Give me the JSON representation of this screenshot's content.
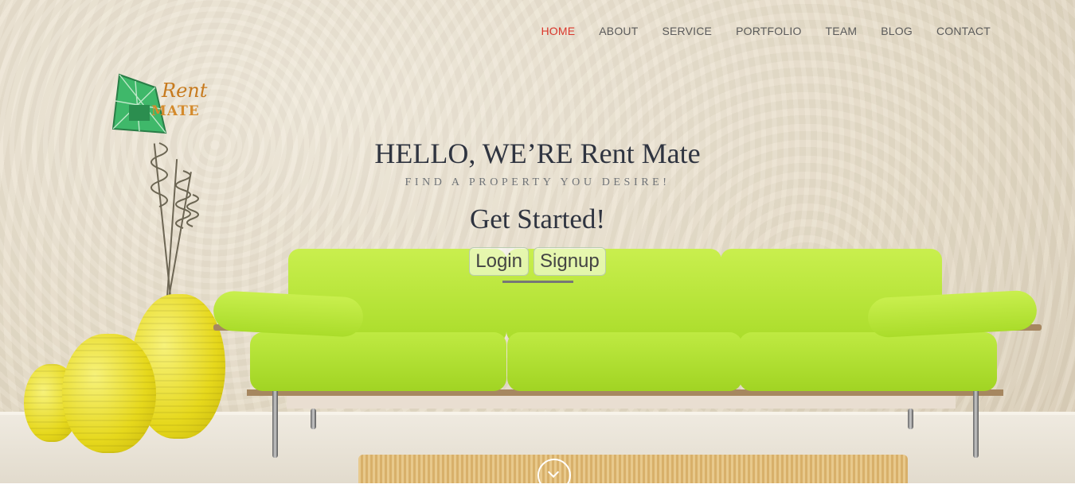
{
  "nav": {
    "items": [
      {
        "label": "HOME",
        "active": true
      },
      {
        "label": "ABOUT"
      },
      {
        "label": "SERVICE"
      },
      {
        "label": "PORTFOLIO"
      },
      {
        "label": "TEAM"
      },
      {
        "label": "BLOG"
      },
      {
        "label": "CONTACT"
      }
    ],
    "active_color": "#d9362b"
  },
  "logo": {
    "line1": "Rent",
    "line2": "MATE"
  },
  "hero": {
    "title": "HELLO, WE’RE Rent Mate",
    "tagline": "FIND A PROPERTY YOU DESIRE!",
    "cta": "Get Started!",
    "buttons": {
      "login": "Login",
      "signup": "Signup"
    }
  },
  "icons": {
    "scroll": "chevron-down-circle-icon"
  }
}
